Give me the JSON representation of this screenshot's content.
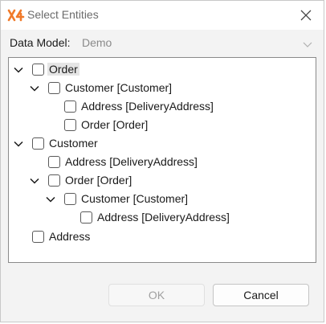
{
  "window": {
    "title": "Select Entities",
    "logo_text": "X4",
    "brand_color": "#f07a2a"
  },
  "data_model": {
    "label": "Data Model:",
    "value": "Demo"
  },
  "tree": {
    "nodes": [
      {
        "label": "Order",
        "expanded": true,
        "checked": false,
        "selected": true
      },
      {
        "label": "Customer [Customer]",
        "expanded": true,
        "checked": false
      },
      {
        "label": "Address [DeliveryAddress]",
        "checked": false
      },
      {
        "label": "Order [Order]",
        "checked": false
      },
      {
        "label": "Customer",
        "expanded": true,
        "checked": false
      },
      {
        "label": "Address [DeliveryAddress]",
        "checked": false
      },
      {
        "label": "Order [Order]",
        "expanded": true,
        "checked": false
      },
      {
        "label": "Customer [Customer]",
        "expanded": true,
        "checked": false
      },
      {
        "label": "Address [DeliveryAddress]",
        "checked": false
      },
      {
        "label": "Address",
        "checked": false
      }
    ]
  },
  "buttons": {
    "ok_label": "OK",
    "ok_enabled": false,
    "cancel_label": "Cancel"
  },
  "icons": {
    "close": "close-icon",
    "dropdown": "chevron-down-icon",
    "expander": "chevron-down-icon"
  }
}
